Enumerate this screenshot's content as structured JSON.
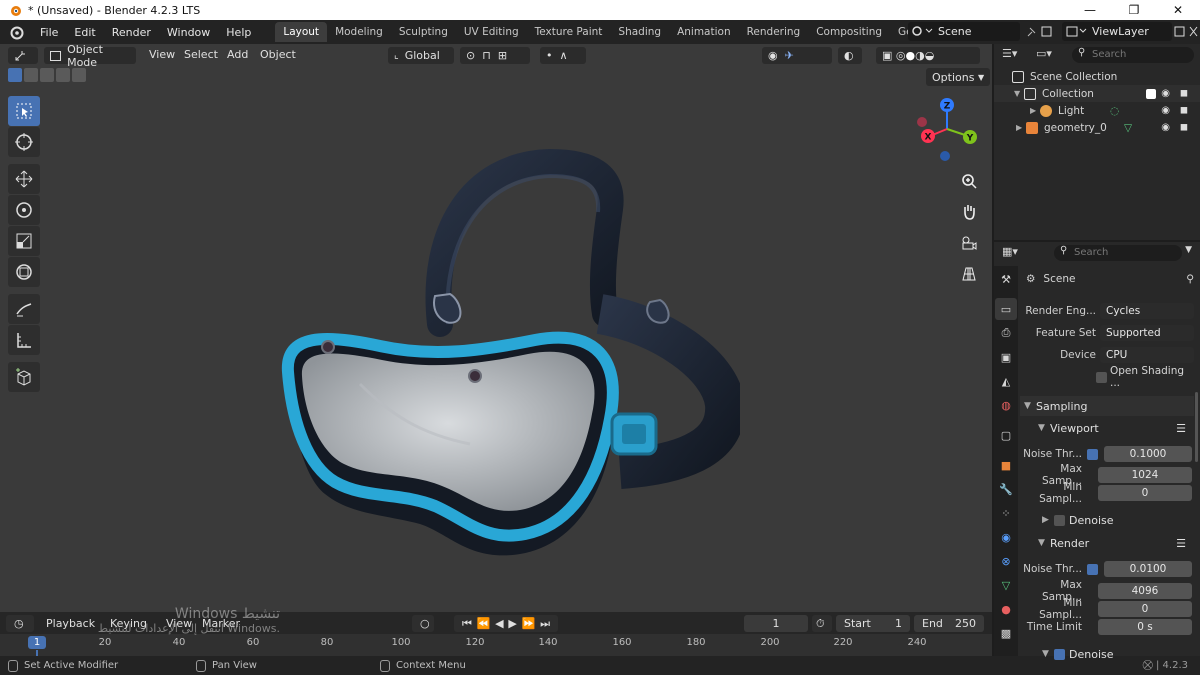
{
  "window": {
    "title": "* (Unsaved) - Blender 4.2.3 LTS",
    "controls": [
      "—",
      "❐",
      "✕"
    ]
  },
  "menu": {
    "items": [
      "File",
      "Edit",
      "Render",
      "Window",
      "Help"
    ]
  },
  "workspaces": [
    "Layout",
    "Modeling",
    "Sculpting",
    "UV Editing",
    "Texture Paint",
    "Shading",
    "Animation",
    "Rendering",
    "Compositing",
    "Geometry Nodes"
  ],
  "active_workspace": "Layout",
  "scene": {
    "name": "Scene"
  },
  "view_layer": {
    "name": "ViewLayer"
  },
  "viewport": {
    "mode": "Object Mode",
    "menus": [
      "View",
      "Select",
      "Add",
      "Object"
    ],
    "transform_orientation": "Global",
    "options_label": "Options",
    "gizmo_axes": {
      "x": "X",
      "y": "Y",
      "z": "Z"
    }
  },
  "outliner": {
    "search_placeholder": "Search",
    "root": "Scene Collection",
    "collection": "Collection",
    "items": [
      "Light",
      "geometry_0"
    ]
  },
  "properties": {
    "search_placeholder": "Search",
    "context": "Scene",
    "render_engine_label": "Render Eng...",
    "render_engine": "Cycles",
    "feature_set_label": "Feature Set",
    "feature_set": "Supported",
    "device_label": "Device",
    "device": "CPU",
    "open_shading": "Open Shading ...",
    "sampling": "Sampling",
    "viewport_section": "Viewport",
    "vp_noise_label": "Noise Thr...",
    "vp_noise": "0.1000",
    "vp_max_label": "Max Samp...",
    "vp_max": "1024",
    "vp_min_label": "Min Sampl...",
    "vp_min": "0",
    "denoise": "Denoise",
    "render_section": "Render",
    "r_noise_label": "Noise Thr...",
    "r_noise": "0.0100",
    "r_max_label": "Max Samp...",
    "r_max": "4096",
    "r_min_label": "Min Sampl...",
    "r_min": "0",
    "time_limit_label": "Time Limit",
    "time_limit": "0 s",
    "denoise2": "Denoise"
  },
  "timeline": {
    "menus": [
      "Playback",
      "Keying",
      "View",
      "Marker"
    ],
    "current_frame": "1",
    "start_label": "Start",
    "start": "1",
    "end_label": "End",
    "end": "250",
    "ticks": [
      "1",
      "20",
      "40",
      "60",
      "80",
      "100",
      "120",
      "140",
      "160",
      "180",
      "200",
      "220",
      "240"
    ]
  },
  "watermark": {
    "line1": "Windows تنشيط",
    "line2": "انتقل إلى الإعدادات لتنشيط Windows."
  },
  "status": {
    "left": "Set Active Modifier",
    "middle": "Pan View",
    "right": "Context Menu",
    "version": "4.2.3"
  },
  "colors": {
    "accent": "#4772b3",
    "viewport_bg": "#3a3a3a",
    "mask_frame": "#29a7d6",
    "strap": "#1a2230"
  }
}
